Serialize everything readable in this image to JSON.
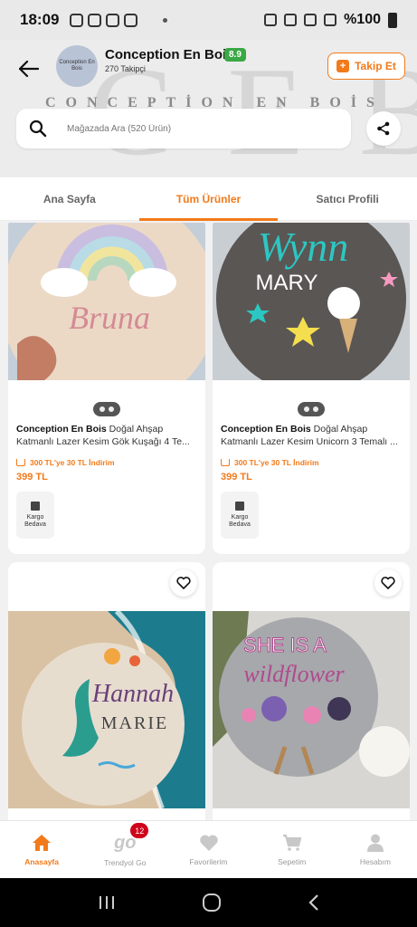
{
  "status_bar": {
    "time": "18:09",
    "battery": "%100"
  },
  "store": {
    "name": "Conception En Bois",
    "rating": "8.9",
    "followers": "270 Takipçi",
    "logo_text": "Conception En Bois",
    "follow_label": "Takip Et",
    "background_letters": "CEB",
    "background_brand": "CONCEPTİON EN BOİS"
  },
  "search": {
    "placeholder": "Mağazada Ara (520 Ürün)"
  },
  "tabs": [
    {
      "label": "Ana Sayfa"
    },
    {
      "label": "Tüm Ürünler"
    },
    {
      "label": "Satıcı Profili"
    }
  ],
  "products": [
    {
      "brand": "Conception En Bois",
      "title": " Doğal Ahşap Katmanlı Lazer Kesim Gök Kuşağı 4 Te...",
      "promo": "300 TL'ye 30 TL İndirim",
      "price": "399 TL",
      "kargo": "Kargo Bedava",
      "image_text": "Bruna"
    },
    {
      "brand": "Conception En Bois",
      "title": " Doğal Ahşap Katmanlı Lazer Kesim Unicorn 3 Temalı ...",
      "promo": "300 TL'ye 30 TL İndirim",
      "price": "399 TL",
      "kargo": "Kargo Bedava",
      "image_text_1": "Wynn",
      "image_text_2": "MARY"
    },
    {
      "image_text_1": "Hannah",
      "image_text_2": "MARIE"
    },
    {
      "image_text_1": "SHE IS A",
      "image_text_2": "wildflower"
    }
  ],
  "bottom_nav": [
    {
      "label": "Anasayfa"
    },
    {
      "label": "Trendyol Go",
      "badge": "12",
      "logo": "go"
    },
    {
      "label": "Favorilerim"
    },
    {
      "label": "Sepetim"
    },
    {
      "label": "Hesabım"
    }
  ],
  "colors": {
    "accent": "#f27a1a",
    "rating_green": "#3aa845",
    "badge_red": "#d0021b"
  },
  "icons": [
    "back-arrow-icon",
    "search-icon",
    "share-icon",
    "heart-icon",
    "home-icon",
    "cart-icon",
    "user-icon",
    "shipping-box-icon"
  ]
}
